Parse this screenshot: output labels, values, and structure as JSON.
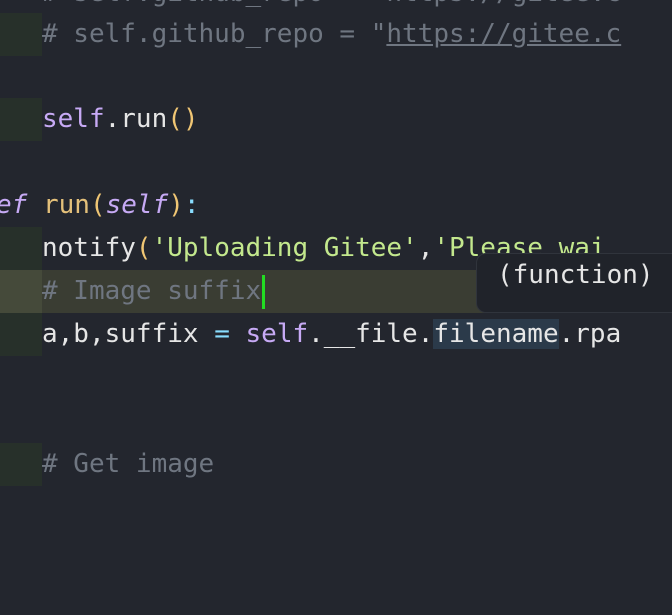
{
  "editor": {
    "partial_top_line": "# self.github_repo = \"https://gitee.c",
    "lines": [
      {
        "comment_prefix": "# self.github_repo = \"",
        "url": "https://gitee.c"
      },
      {
        "self": "self",
        "dot": ".",
        "method": "run",
        "parens": "()"
      },
      {
        "kw": "ef",
        "name": "run",
        "open": "(",
        "param": "self",
        "close": ")",
        "colon": ":"
      },
      {
        "call": "notify",
        "open": "(",
        "str1": "'Uploading Gitee'",
        "comma": ",",
        "str2": "'Please wai"
      },
      {
        "comment": "# Image suffix"
      },
      {
        "vars": "a,b,suffix",
        "eq": " = ",
        "self": "self",
        "attr": ".__file.",
        "highlight": "filename",
        "rest": ".rpa"
      },
      {
        "comment": "# Get image"
      }
    ]
  },
  "tooltip": {
    "text": "(function)"
  }
}
